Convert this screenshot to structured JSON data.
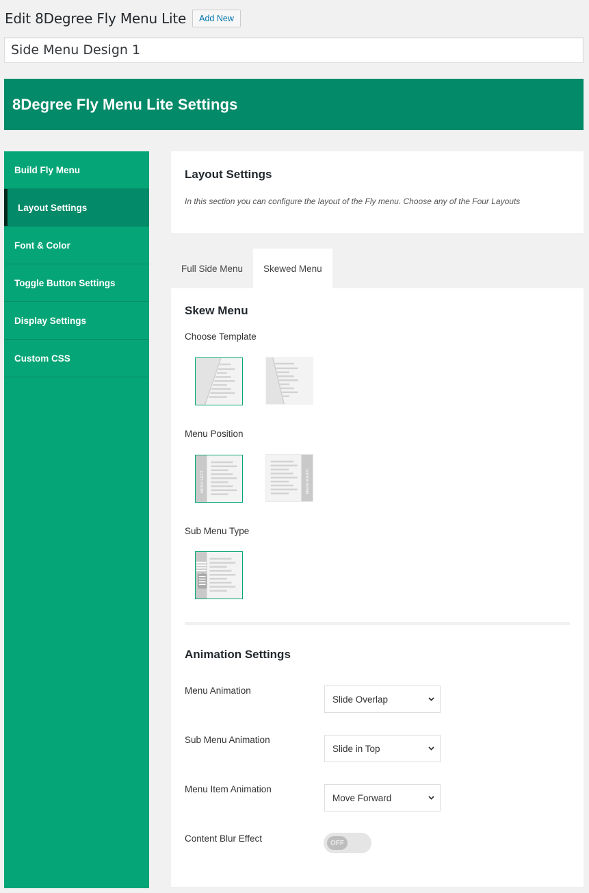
{
  "header": {
    "title": "Edit 8Degree Fly Menu Lite",
    "add_new_label": "Add New",
    "post_title_value": "Side Menu Design 1"
  },
  "banner": {
    "title": "8Degree Fly Menu Lite Settings",
    "color": "#038a68"
  },
  "sidebar": {
    "accent_color": "#06a577",
    "items": [
      {
        "label": "Build Fly Menu",
        "active": false
      },
      {
        "label": "Layout Settings",
        "active": true
      },
      {
        "label": "Font & Color",
        "active": false
      },
      {
        "label": "Toggle Button Settings",
        "active": false
      },
      {
        "label": "Display Settings",
        "active": false
      },
      {
        "label": "Custom CSS",
        "active": false
      }
    ]
  },
  "layout_panel": {
    "title": "Layout Settings",
    "description": "In this section you can configure the layout of the Fly menu. Choose any of the Four Layouts"
  },
  "tabs": [
    {
      "label": "Full Side Menu",
      "active": false
    },
    {
      "label": "Skewed Menu",
      "active": true
    }
  ],
  "skew_menu": {
    "title": "Skew Menu",
    "choose_template_label": "Choose Template",
    "templates": [
      {
        "icon": "skew-template-1-icon",
        "selected": true
      },
      {
        "icon": "skew-template-2-icon",
        "selected": false
      }
    ],
    "menu_position_label": "Menu Position",
    "positions": [
      {
        "icon": "menu-left-icon",
        "text": "MENU LEFT",
        "selected": true
      },
      {
        "icon": "menu-right-icon",
        "text": "MENU RIGHT",
        "selected": false
      }
    ],
    "sub_menu_type_label": "Sub Menu Type",
    "sub_menu_types": [
      {
        "icon": "sub-menu-type-icon",
        "selected": true
      }
    ]
  },
  "animation": {
    "title": "Animation Settings",
    "fields": [
      {
        "label": "Menu Animation",
        "value": "Slide Overlap"
      },
      {
        "label": "Sub Menu Animation",
        "value": "Slide in Top"
      },
      {
        "label": "Menu Item Animation",
        "value": "Move Forward"
      }
    ],
    "blur": {
      "label": "Content Blur Effect",
      "state": "OFF"
    }
  }
}
